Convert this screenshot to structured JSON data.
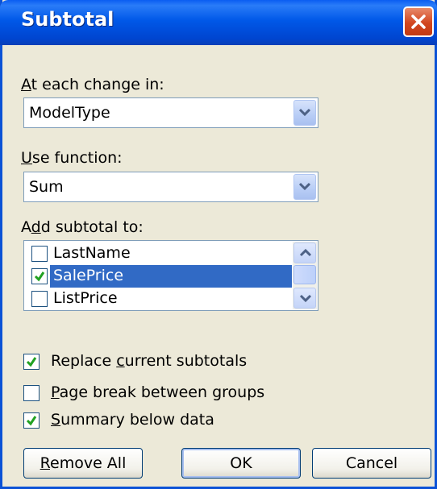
{
  "window": {
    "title": "Subtotal"
  },
  "change_in": {
    "label": "At each change in:",
    "accel_char": "A",
    "label_rest": "t each change in:",
    "value": "ModelType"
  },
  "use_function": {
    "label": "Use function:",
    "accel_char": "U",
    "label_rest": "se function:",
    "value": "Sum"
  },
  "add_subtotal": {
    "label": "Add subtotal to:",
    "label_pre": "A",
    "accel_char": "d",
    "label_rest": "d subtotal to:",
    "items": [
      {
        "label": "LastName",
        "checked": false,
        "selected": false
      },
      {
        "label": "SalePrice",
        "checked": true,
        "selected": true
      },
      {
        "label": "ListPrice",
        "checked": false,
        "selected": false
      }
    ]
  },
  "options": {
    "replace": {
      "label": "Replace current subtotals",
      "pre": "Replace ",
      "accel_char": "c",
      "rest": "urrent subtotals",
      "checked": true
    },
    "page_break": {
      "label": "Page break between groups",
      "pre": "",
      "accel_char": "P",
      "rest": "age break between groups",
      "checked": false
    },
    "summary": {
      "label": "Summary below data",
      "pre": "",
      "accel_char": "S",
      "rest": "ummary below data",
      "checked": true
    }
  },
  "buttons": {
    "remove_all": {
      "accel_char": "R",
      "rest": "emove All",
      "label": "Remove All"
    },
    "ok": "OK",
    "cancel": "Cancel"
  },
  "colors": {
    "title_blue": "#0058e8",
    "dialog_bg": "#ece9d8",
    "selection": "#316ac5",
    "check_green": "#21a121",
    "close_red": "#d2461f"
  }
}
